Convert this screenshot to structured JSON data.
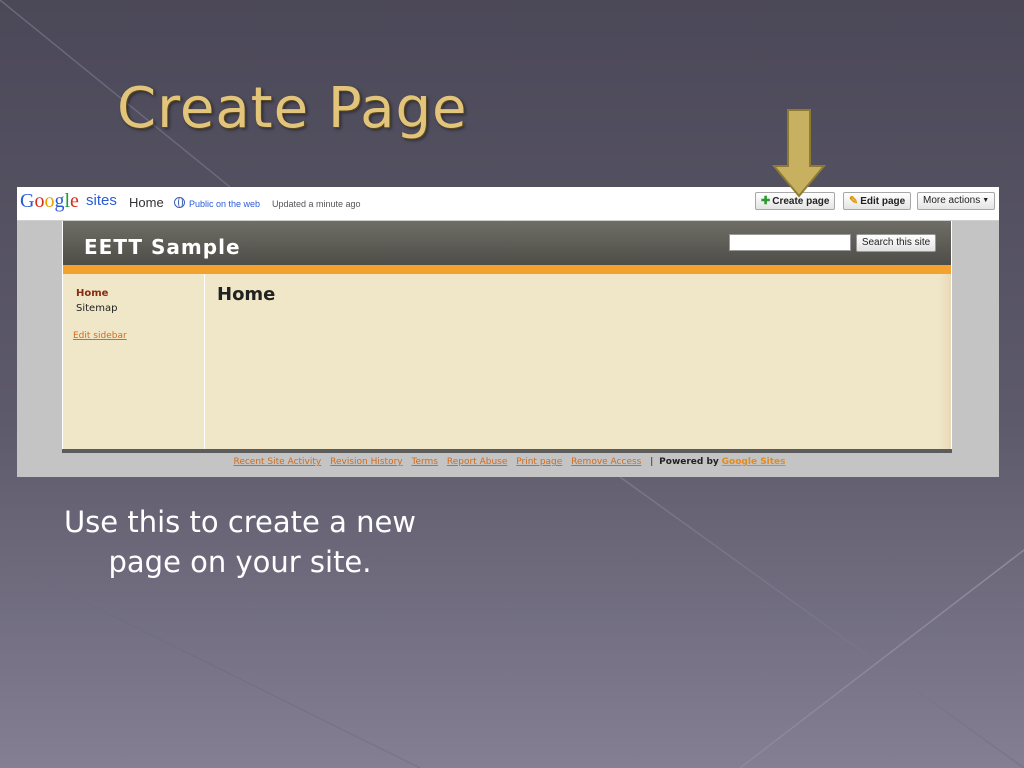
{
  "slide": {
    "title": "Create Page",
    "caption": "Use this to create a new page on your site."
  },
  "topbar": {
    "logo_letters": [
      "G",
      "o",
      "o",
      "g",
      "l",
      "e"
    ],
    "product": "sites",
    "page_name": "Home",
    "visibility": "Public on the web",
    "updated": "Updated a minute ago",
    "create_label": "Create page",
    "edit_label": "Edit page",
    "more_label": "More actions"
  },
  "site": {
    "name": "EETT Sample",
    "search_button": "Search this site",
    "search_value": "",
    "sidebar": {
      "home": "Home",
      "sitemap": "Sitemap",
      "edit": "Edit sidebar"
    },
    "page_heading": "Home"
  },
  "footer": {
    "links": [
      "Recent Site Activity",
      "Revision History",
      "Terms",
      "Report Abuse",
      "Print page",
      "Remove Access"
    ],
    "separator": "|",
    "powered_by": "Powered by",
    "powered_link": "Google Sites"
  },
  "colors": {
    "title_gold": "#e2c47a",
    "arrow_gold": "#c7b160",
    "orange_bar": "#f5a12d",
    "link_orange": "#d26b1d",
    "page_bg": "#efe7c8"
  },
  "icons": [
    "arrow-down-icon",
    "globe-icon",
    "plus-icon",
    "pencil-icon",
    "caret-down-icon"
  ]
}
